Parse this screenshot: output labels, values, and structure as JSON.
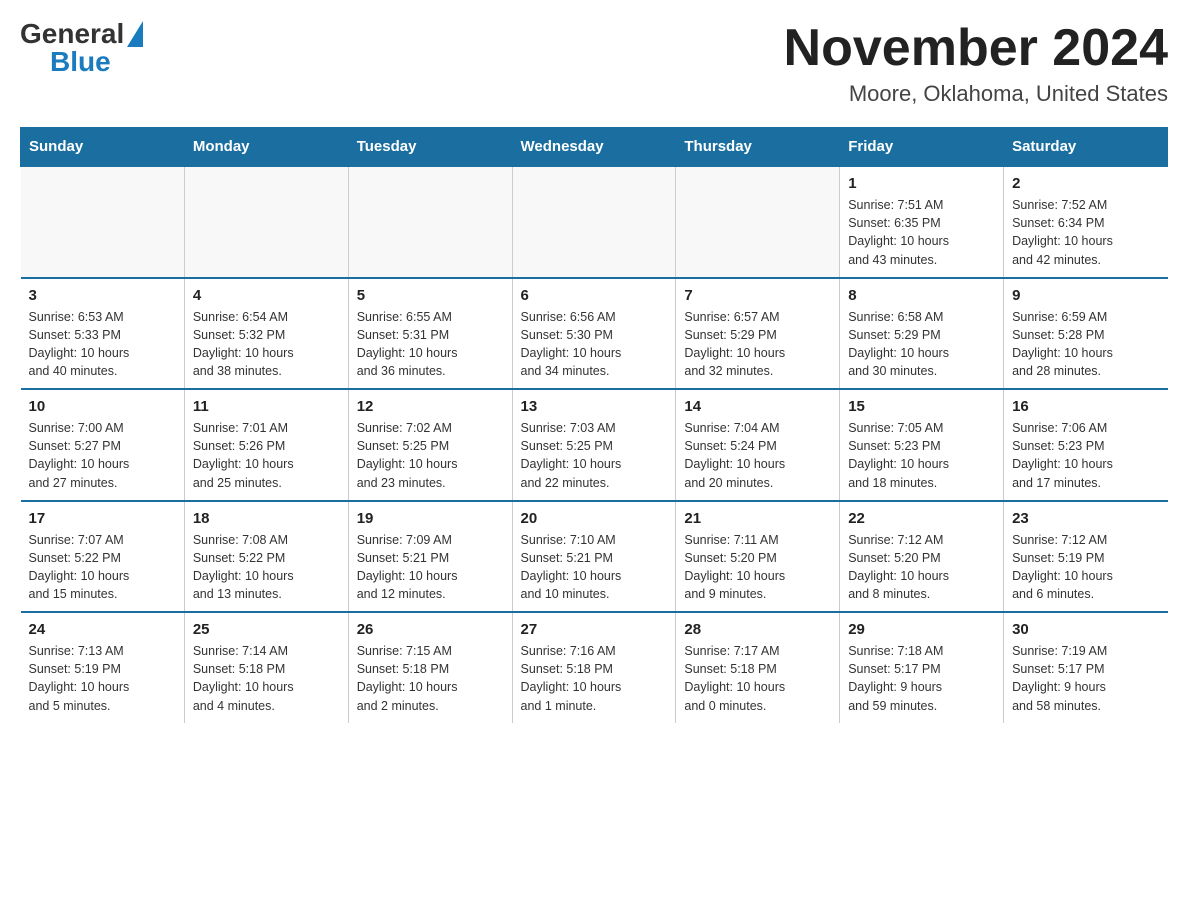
{
  "logo": {
    "general": "General",
    "blue": "Blue",
    "triangle": "▶"
  },
  "title": "November 2024",
  "subtitle": "Moore, Oklahoma, United States",
  "days_of_week": [
    "Sunday",
    "Monday",
    "Tuesday",
    "Wednesday",
    "Thursday",
    "Friday",
    "Saturday"
  ],
  "weeks": [
    [
      {
        "day": "",
        "info": ""
      },
      {
        "day": "",
        "info": ""
      },
      {
        "day": "",
        "info": ""
      },
      {
        "day": "",
        "info": ""
      },
      {
        "day": "",
        "info": ""
      },
      {
        "day": "1",
        "info": "Sunrise: 7:51 AM\nSunset: 6:35 PM\nDaylight: 10 hours\nand 43 minutes."
      },
      {
        "day": "2",
        "info": "Sunrise: 7:52 AM\nSunset: 6:34 PM\nDaylight: 10 hours\nand 42 minutes."
      }
    ],
    [
      {
        "day": "3",
        "info": "Sunrise: 6:53 AM\nSunset: 5:33 PM\nDaylight: 10 hours\nand 40 minutes."
      },
      {
        "day": "4",
        "info": "Sunrise: 6:54 AM\nSunset: 5:32 PM\nDaylight: 10 hours\nand 38 minutes."
      },
      {
        "day": "5",
        "info": "Sunrise: 6:55 AM\nSunset: 5:31 PM\nDaylight: 10 hours\nand 36 minutes."
      },
      {
        "day": "6",
        "info": "Sunrise: 6:56 AM\nSunset: 5:30 PM\nDaylight: 10 hours\nand 34 minutes."
      },
      {
        "day": "7",
        "info": "Sunrise: 6:57 AM\nSunset: 5:29 PM\nDaylight: 10 hours\nand 32 minutes."
      },
      {
        "day": "8",
        "info": "Sunrise: 6:58 AM\nSunset: 5:29 PM\nDaylight: 10 hours\nand 30 minutes."
      },
      {
        "day": "9",
        "info": "Sunrise: 6:59 AM\nSunset: 5:28 PM\nDaylight: 10 hours\nand 28 minutes."
      }
    ],
    [
      {
        "day": "10",
        "info": "Sunrise: 7:00 AM\nSunset: 5:27 PM\nDaylight: 10 hours\nand 27 minutes."
      },
      {
        "day": "11",
        "info": "Sunrise: 7:01 AM\nSunset: 5:26 PM\nDaylight: 10 hours\nand 25 minutes."
      },
      {
        "day": "12",
        "info": "Sunrise: 7:02 AM\nSunset: 5:25 PM\nDaylight: 10 hours\nand 23 minutes."
      },
      {
        "day": "13",
        "info": "Sunrise: 7:03 AM\nSunset: 5:25 PM\nDaylight: 10 hours\nand 22 minutes."
      },
      {
        "day": "14",
        "info": "Sunrise: 7:04 AM\nSunset: 5:24 PM\nDaylight: 10 hours\nand 20 minutes."
      },
      {
        "day": "15",
        "info": "Sunrise: 7:05 AM\nSunset: 5:23 PM\nDaylight: 10 hours\nand 18 minutes."
      },
      {
        "day": "16",
        "info": "Sunrise: 7:06 AM\nSunset: 5:23 PM\nDaylight: 10 hours\nand 17 minutes."
      }
    ],
    [
      {
        "day": "17",
        "info": "Sunrise: 7:07 AM\nSunset: 5:22 PM\nDaylight: 10 hours\nand 15 minutes."
      },
      {
        "day": "18",
        "info": "Sunrise: 7:08 AM\nSunset: 5:22 PM\nDaylight: 10 hours\nand 13 minutes."
      },
      {
        "day": "19",
        "info": "Sunrise: 7:09 AM\nSunset: 5:21 PM\nDaylight: 10 hours\nand 12 minutes."
      },
      {
        "day": "20",
        "info": "Sunrise: 7:10 AM\nSunset: 5:21 PM\nDaylight: 10 hours\nand 10 minutes."
      },
      {
        "day": "21",
        "info": "Sunrise: 7:11 AM\nSunset: 5:20 PM\nDaylight: 10 hours\nand 9 minutes."
      },
      {
        "day": "22",
        "info": "Sunrise: 7:12 AM\nSunset: 5:20 PM\nDaylight: 10 hours\nand 8 minutes."
      },
      {
        "day": "23",
        "info": "Sunrise: 7:12 AM\nSunset: 5:19 PM\nDaylight: 10 hours\nand 6 minutes."
      }
    ],
    [
      {
        "day": "24",
        "info": "Sunrise: 7:13 AM\nSunset: 5:19 PM\nDaylight: 10 hours\nand 5 minutes."
      },
      {
        "day": "25",
        "info": "Sunrise: 7:14 AM\nSunset: 5:18 PM\nDaylight: 10 hours\nand 4 minutes."
      },
      {
        "day": "26",
        "info": "Sunrise: 7:15 AM\nSunset: 5:18 PM\nDaylight: 10 hours\nand 2 minutes."
      },
      {
        "day": "27",
        "info": "Sunrise: 7:16 AM\nSunset: 5:18 PM\nDaylight: 10 hours\nand 1 minute."
      },
      {
        "day": "28",
        "info": "Sunrise: 7:17 AM\nSunset: 5:18 PM\nDaylight: 10 hours\nand 0 minutes."
      },
      {
        "day": "29",
        "info": "Sunrise: 7:18 AM\nSunset: 5:17 PM\nDaylight: 9 hours\nand 59 minutes."
      },
      {
        "day": "30",
        "info": "Sunrise: 7:19 AM\nSunset: 5:17 PM\nDaylight: 9 hours\nand 58 minutes."
      }
    ]
  ]
}
